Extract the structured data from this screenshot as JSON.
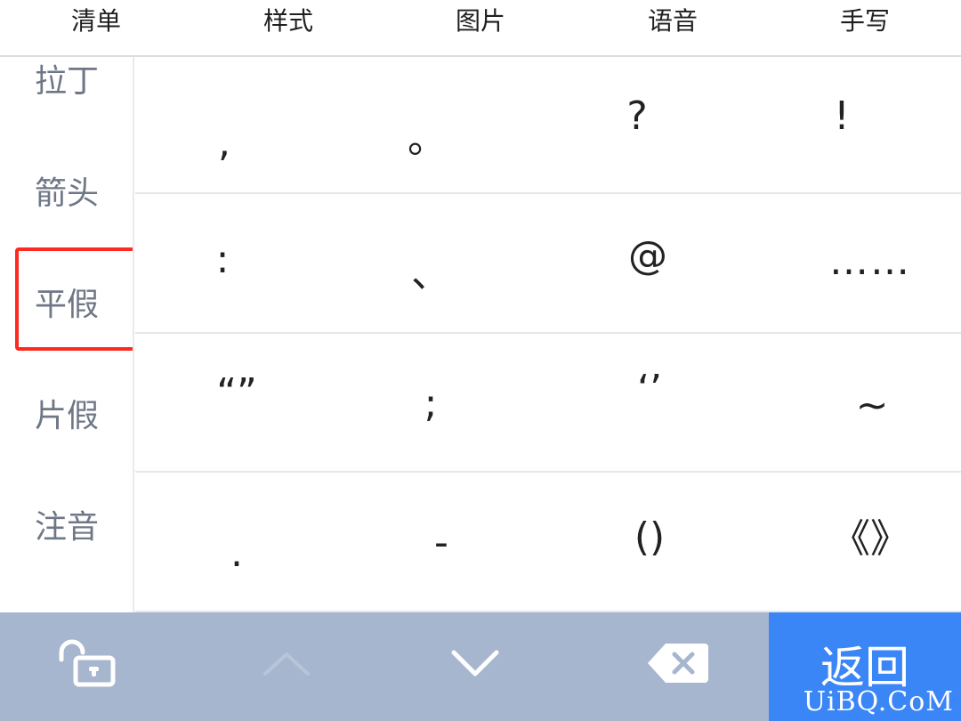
{
  "tabs": [
    {
      "label": "清单"
    },
    {
      "label": "样式"
    },
    {
      "label": "图片"
    },
    {
      "label": "语音"
    },
    {
      "label": "手写"
    }
  ],
  "categories": [
    {
      "label": "拉丁"
    },
    {
      "label": "箭头"
    },
    {
      "label": "平假"
    },
    {
      "label": "片假"
    },
    {
      "label": "注音"
    }
  ],
  "symbols": [
    [
      ",",
      "。",
      "?",
      "!"
    ],
    [
      ":",
      "、",
      "@",
      "……"
    ],
    [
      "“”",
      ";",
      "‘’",
      "~"
    ],
    [
      ".",
      "-",
      "()",
      "《》"
    ]
  ],
  "toolbar": {
    "lock_icon": "unlock-icon",
    "up_icon": "chevron-up-icon",
    "down_icon": "chevron-down-icon",
    "delete_icon": "backspace-icon",
    "return_label": "返回",
    "watermark": "UiBQ.CoM"
  },
  "colors": {
    "toolbar_bg": "#a7b6cf",
    "return_bg": "#3b86f7",
    "highlight": "#ff2a1f",
    "category_text": "#6f7787"
  }
}
